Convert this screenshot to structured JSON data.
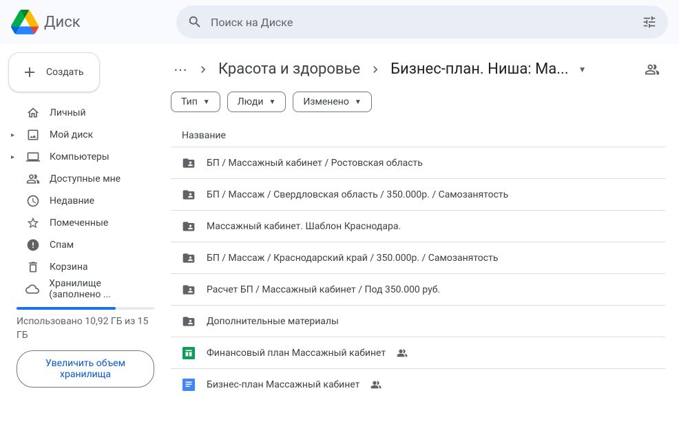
{
  "header": {
    "brand": "Диск",
    "search_placeholder": "Поиск на Диске"
  },
  "sidebar": {
    "create_label": "Создать",
    "nav": [
      {
        "label": "Личный",
        "icon": "home",
        "expandable": false
      },
      {
        "label": "Мой диск",
        "icon": "drive",
        "expandable": true
      },
      {
        "label": "Компьютеры",
        "icon": "computer",
        "expandable": true
      }
    ],
    "nav2": [
      {
        "label": "Доступные мне",
        "icon": "shared"
      },
      {
        "label": "Недавние",
        "icon": "recent"
      },
      {
        "label": "Помеченные",
        "icon": "star"
      }
    ],
    "nav3": [
      {
        "label": "Спам",
        "icon": "spam"
      },
      {
        "label": "Корзина",
        "icon": "trash"
      },
      {
        "label": "Хранилище (заполнено ...",
        "icon": "cloud"
      }
    ],
    "storage": {
      "text": "Использовано 10,92 ГБ из 15 ГБ",
      "upgrade": "Увеличить объем хранилища",
      "percent": 72
    }
  },
  "breadcrumb": {
    "parent": "Красота и здоровье",
    "current": "Бизнес-план. Ниша: Ма..."
  },
  "filters": [
    {
      "label": "Тип"
    },
    {
      "label": "Люди"
    },
    {
      "label": "Изменено"
    }
  ],
  "list": {
    "header": "Название",
    "rows": [
      {
        "icon": "folder-shared",
        "name": "БП / Массажный кабинет / Ростовская область",
        "shared": false
      },
      {
        "icon": "folder-shared",
        "name": "БП / Массаж / Свердловская область / 350.000р. / Самозанятость",
        "shared": false
      },
      {
        "icon": "folder-shared",
        "name": "Массажный кабинет. Шаблон Краснодара.",
        "shared": false
      },
      {
        "icon": "folder-shared",
        "name": "БП / Массаж / Краснодарский край / 350.000р. / Самозанятость",
        "shared": false
      },
      {
        "icon": "folder-shared",
        "name": "Расчет БП / Массажный кабинет / Под 350.000 руб.",
        "shared": false
      },
      {
        "icon": "folder-shared",
        "name": "Дополнительные материалы",
        "shared": false
      },
      {
        "icon": "sheets",
        "name": "Финансовый план Массажный кабинет",
        "shared": true
      },
      {
        "icon": "docs",
        "name": "Бизнес-план Массажный кабинет",
        "shared": true
      }
    ]
  }
}
